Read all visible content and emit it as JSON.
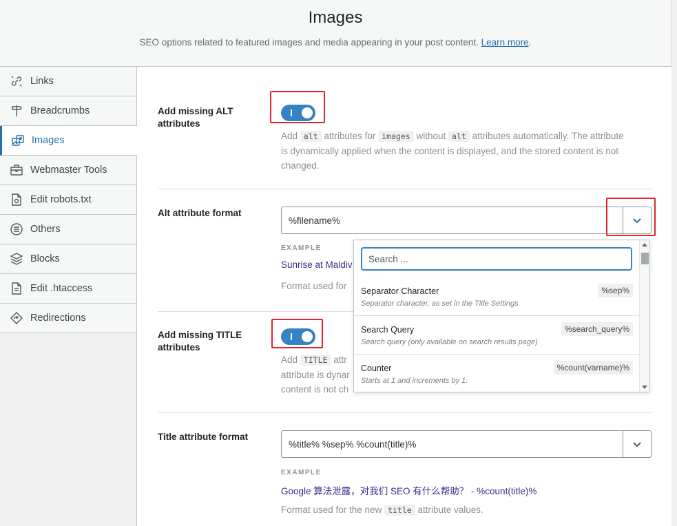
{
  "header": {
    "title": "Images",
    "subtitle": "SEO options related to featured images and media appearing in your post content.",
    "learn_more": "Learn more",
    "period": "."
  },
  "sidebar": {
    "items": [
      {
        "label": "Links",
        "icon": "links-icon"
      },
      {
        "label": "Breadcrumbs",
        "icon": "signpost-icon"
      },
      {
        "label": "Images",
        "icon": "images-icon",
        "active": true
      },
      {
        "label": "Webmaster Tools",
        "icon": "toolbox-icon"
      },
      {
        "label": "Edit robots.txt",
        "icon": "robot-file-icon"
      },
      {
        "label": "Others",
        "icon": "list-circle-icon"
      },
      {
        "label": "Blocks",
        "icon": "blocks-icon"
      },
      {
        "label": "Edit .htaccess",
        "icon": "file-icon"
      },
      {
        "label": "Redirections",
        "icon": "redirect-icon"
      }
    ]
  },
  "settings": {
    "alt_missing": {
      "label": "Add missing ALT attributes",
      "enabled": true,
      "desc_1": "Add",
      "code_1": "alt",
      "desc_2": "attributes for",
      "code_2": "images",
      "desc_3": "without",
      "code_3": "alt",
      "desc_4": "attributes automatically. The attribute is dynamically applied when the content is displayed, and the stored content is not changed."
    },
    "alt_format": {
      "label": "Alt attribute format",
      "value": "%filename%",
      "example_label": "EXAMPLE",
      "example_value": "Sunrise at Maldiv",
      "format_desc": "Format used for"
    },
    "title_missing": {
      "label": "Add missing TITLE attributes",
      "enabled": true,
      "desc_1": "Add",
      "code_1": "TITLE",
      "desc_2": "attr",
      "desc_3": "attribute is dynar",
      "desc_4": "content is not ch"
    },
    "title_format": {
      "label": "Title attribute format",
      "value": "%title% %sep% %count(title)%",
      "example_label": "EXAMPLE",
      "example_value": "Google 算法泄露，对我们 SEO 有什么帮助？ - %count(title)%",
      "format_desc_1": "Format used for the new",
      "format_code": "title",
      "format_desc_2": "attribute values."
    }
  },
  "dropdown": {
    "search_placeholder": "Search ...",
    "items": [
      {
        "title": "Separator Character",
        "desc": "Separator character, as set in the Title Settings",
        "tag": "%sep%"
      },
      {
        "title": "Search Query",
        "desc": "Search query (only available on search results page)",
        "tag": "%search_query%"
      },
      {
        "title": "Counter",
        "desc": "Starts at 1 and increments by 1.",
        "tag": "%count(varname)%"
      }
    ]
  },
  "colors": {
    "accent": "#2271b1",
    "toggle_on": "#3582c4",
    "highlight": "#e1242a"
  }
}
